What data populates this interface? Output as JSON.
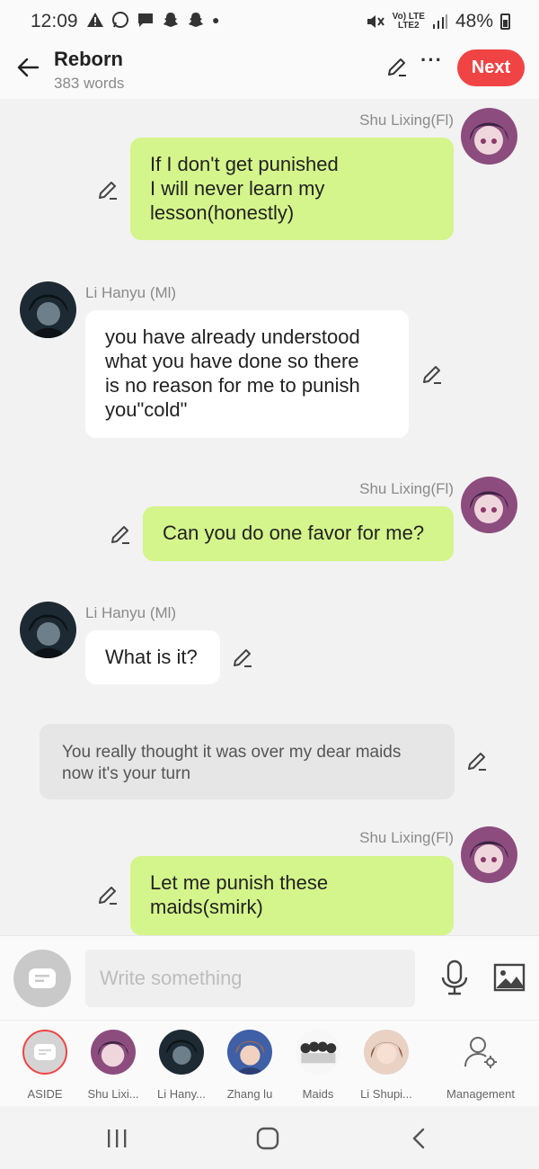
{
  "status": {
    "time": "12:09",
    "network_top": "Vo) LTE",
    "network_bottom": "LTE2",
    "battery": "48%"
  },
  "header": {
    "title": "Reborn",
    "word_count": "383 words",
    "next_label": "Next"
  },
  "messages": [
    {
      "side": "right",
      "sender": "Shu Lixing(Fl)",
      "text": "If I don't get punished\nI will never learn my\nlesson(honestly)"
    },
    {
      "side": "left",
      "sender": "Li Hanyu (Ml)",
      "text": "you have already understood\nwhat you have done so there\nis no reason for me to punish\nyou\"cold\""
    },
    {
      "side": "right",
      "sender": "Shu Lixing(Fl)",
      "text": "Can you do one favor for me?"
    },
    {
      "side": "left",
      "sender": "Li Hanyu (Ml)",
      "text": "What is it?"
    },
    {
      "side": "aside",
      "sender": "",
      "text": "You really thought it was over my dear maids\nnow it's your turn"
    },
    {
      "side": "right",
      "sender": "Shu Lixing(Fl)",
      "text": "Let me punish these\nmaids(smirk)"
    }
  ],
  "input": {
    "placeholder": "Write something"
  },
  "characters": [
    {
      "label": "ASIDE"
    },
    {
      "label": "Shu Lixi..."
    },
    {
      "label": "Li Hany..."
    },
    {
      "label": "Zhang lu"
    },
    {
      "label": "Maids"
    },
    {
      "label": "Li Shupi..."
    },
    {
      "label": "Management"
    }
  ],
  "colors": {
    "accent": "#f04444",
    "right_bubble": "#d4f58b",
    "left_bubble": "#ffffff",
    "aside_bubble": "#e6e6e6"
  }
}
